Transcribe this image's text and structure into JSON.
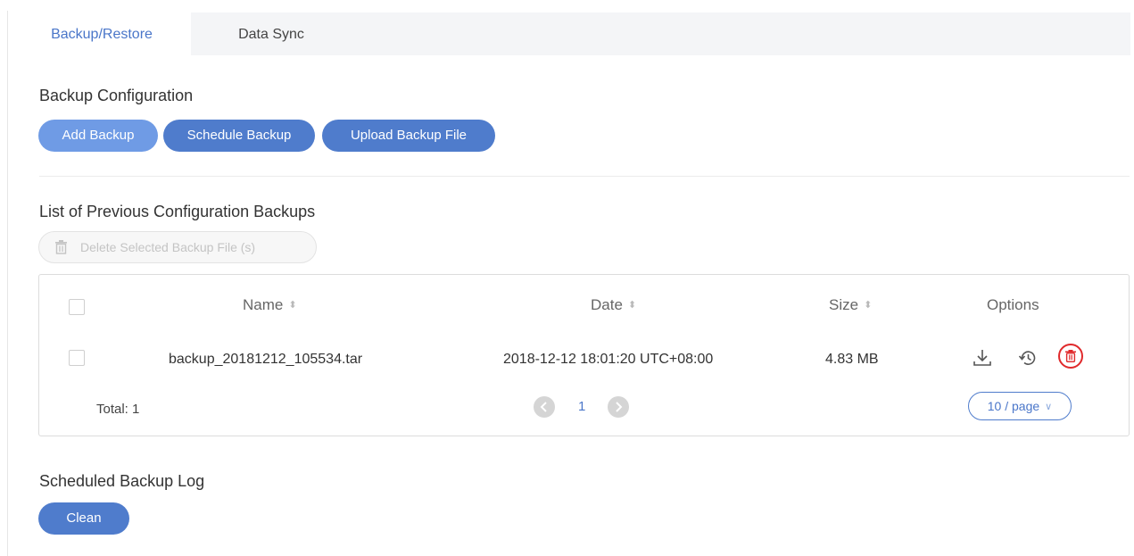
{
  "tabs": [
    {
      "label": "Backup/Restore",
      "active": true
    },
    {
      "label": "Data Sync",
      "active": false
    }
  ],
  "backup_config": {
    "title": "Backup Configuration",
    "buttons": {
      "add": "Add Backup",
      "schedule": "Schedule Backup",
      "upload": "Upload Backup File"
    }
  },
  "previous_backups": {
    "title": "List of Previous Configuration Backups",
    "delete_selected_label": "Delete Selected Backup File (s)",
    "table": {
      "headers": {
        "name": "Name",
        "date": "Date",
        "size": "Size",
        "options": "Options"
      },
      "rows": [
        {
          "name": "backup_20181212_105534.tar",
          "date": "2018-12-12 18:01:20 UTC+08:00",
          "size": "4.83 MB"
        }
      ],
      "total_label": "Total: 1",
      "current_page": "1",
      "page_size": "10 / page"
    }
  },
  "scheduled_log": {
    "title": "Scheduled Backup Log",
    "clean_label": "Clean"
  },
  "colors": {
    "accent": "#4a76c9",
    "button_light": "#6f9be5",
    "button_dark": "#4f7ccc",
    "danger": "#e0292b"
  },
  "icons": {
    "delete_selected": "trash-icon",
    "download": "download-icon",
    "restore": "restore-history-icon",
    "delete_row": "delete-circle-icon",
    "prev": "chevron-left-icon",
    "next": "chevron-right-icon",
    "sort": "sort-icon",
    "page_size": "chevron-down-icon"
  }
}
